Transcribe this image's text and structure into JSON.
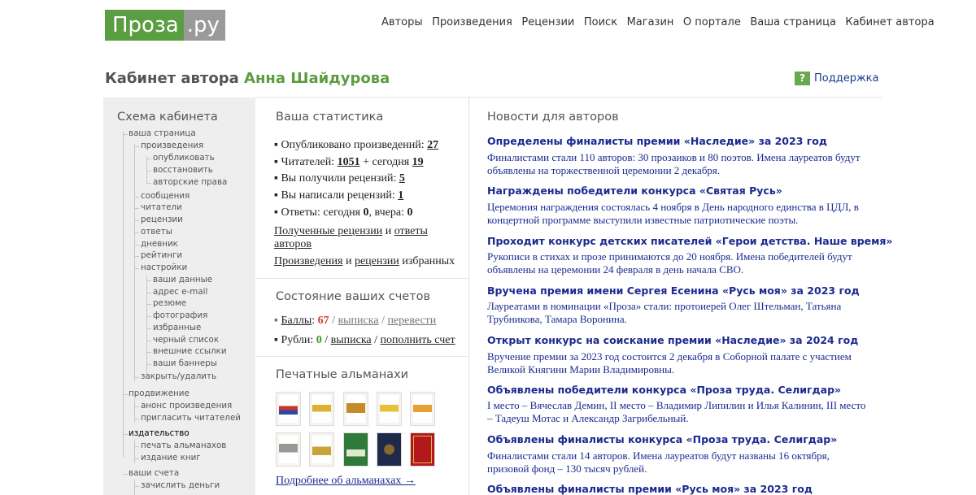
{
  "header": {
    "logo_part1": "Проза",
    "logo_part2": ".ру",
    "nav": [
      "Авторы",
      "Произведения",
      "Рецензии",
      "Поиск",
      "Магазин",
      "О портале",
      "Ваша страница",
      "Кабинет автора"
    ]
  },
  "cabinet": {
    "title_prefix": "Кабинет автора",
    "author_name": "Анна Шайдурова",
    "support_icon": "?",
    "support_label": "Поддержка"
  },
  "sidebar": {
    "title": "Схема кабинета",
    "items": [
      "ваша страница",
      "произведения",
      "опубликовать",
      "восстановить",
      "авторские права",
      "сообщения",
      "читатели",
      "рецензии",
      "ответы",
      "дневник",
      "рейтинги",
      "настройки",
      "ваши данные",
      "адрес e-mail",
      "резюме",
      "фотография",
      "избранные",
      "черный список",
      "внешние ссылки",
      "ваши баннеры",
      "закрыть/удалить",
      "продвижение",
      "анонс произведения",
      "пригласить читателей",
      "издательство",
      "печать альманахов",
      "издание книг",
      "ваши счета",
      "зачислить деньги"
    ]
  },
  "stats": {
    "title": "Ваша статистика",
    "published_label": "Опубликовано произведений:",
    "published": "27",
    "readers_label": "Читателей:",
    "readers": "1051",
    "today_label": "+ сегодня",
    "readers_today": "19",
    "got_reviews_label": "Вы получили рецензий:",
    "got_reviews": "5",
    "wrote_reviews_label": "Вы написали рецензий:",
    "wrote_reviews": "1",
    "answers_label": "Ответы: сегодня",
    "answers_today": "0",
    "answers_yesterday_label": ", вчера:",
    "answers_yesterday": "0",
    "link_received": "Полученные рецензии",
    "and1": "и",
    "link_answers_1": "ответы",
    "link_answers_2": "авторов",
    "link_works": "Произведения",
    "and2": "и",
    "link_reviews": "рецензии",
    "favorites": "избранных"
  },
  "accounts": {
    "title": "Состояние ваших счетов",
    "points_label": "Баллы",
    "points_colon": ":",
    "points": "67",
    "slash1": "/",
    "statement1": "выписка",
    "slash2": "/",
    "transfer": "перевести",
    "rubles_label": "Рубли:",
    "rubles": "0",
    "slash3": "/",
    "statement2": "выписка",
    "slash4": "/",
    "topup": "пополнить счет"
  },
  "almanacs": {
    "title": "Печатные альманахи",
    "more": "Подробнее об альманахах →"
  },
  "news": {
    "title": "Новости для авторов",
    "items": [
      {
        "title": "Определены финалисты премии «Наследие» за 2023 год",
        "body": "Финалистами стали 110 авторов: 30 прозаиков и 80 поэтов. Имена лауреатов будут объявлены на торжественной церемонии 2 декабря."
      },
      {
        "title": "Награждены победители конкурса «Святая Русь»",
        "body": "Церемония награждения состоялась 4 ноября в День народного единства в ЦДЛ, в концертной программе выступили известные патриотические поэты."
      },
      {
        "title": "Проходит конкурс детских писателей «Герои детства. Наше время»",
        "body": "Рукописи в стихах и прозе принимаются до 20 ноября. Имена победителей будут объявлены на церемонии 24 февраля в день начала СВО."
      },
      {
        "title": "Вручена премия имени Сергея Есенина «Русь моя» за 2023 год",
        "body": "Лауреатами в номинации «Проза» стали: протоиерей Олег Штельман, Татьяна Трубникова, Тамара Воронина."
      },
      {
        "title": "Открыт конкурс на соискание премии «Наследие» за 2024 год",
        "body": "Вручение премии за 2023 год состоится 2 декабря в Соборной палате с участием Великой Княгини Марии Владимировны."
      },
      {
        "title": "Объявлены победители конкурса «Проза труда. Селигдар»",
        "body": "I место – Вячеслав Демин, II место – Владимир Липилин и Илья Калинин, III место – Тадеуш Мотас и Александр Загрибельный."
      },
      {
        "title": "Объявлены финалисты конкурса «Проза труда. Селигдар»",
        "body": "Финалистами стали 14 авторов. Имена лауреатов будут названы 16 октября, призовой фонд – 130 тысяч рублей."
      },
      {
        "title": "Объявлены финалисты премии «Русь моя» за 2023 год",
        "body": ""
      }
    ]
  }
}
